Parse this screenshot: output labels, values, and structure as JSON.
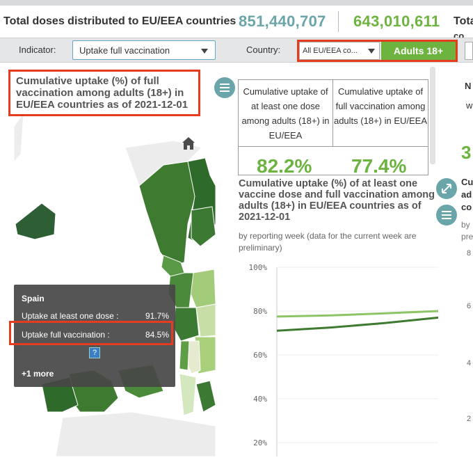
{
  "kpis": {
    "title": "Total doses distributed to EU/EEA countries",
    "value_1": "851,440,707",
    "value_2": "643,010,611",
    "title_2_cut": "Total",
    "title_2_cut_b": "co"
  },
  "filters": {
    "indicator_label": "Indicator:",
    "indicator_value": "Uptake full vaccination",
    "country_label": "Country:",
    "country_value": "All EU/EEA co...",
    "group_button": "Adults 18+"
  },
  "map": {
    "title": "Cumulative uptake (%) of full vaccination among adults (18+) in EU/EEA countries as of 2021-12-01",
    "tooltip": {
      "country": "Spain",
      "rows": [
        {
          "label": "Uptake at least one dose :",
          "value": "91.7%"
        },
        {
          "label": "Uptake full vaccination :",
          "value": "84.5%"
        }
      ],
      "help": "?",
      "more": "+1 more"
    }
  },
  "kpi_table": {
    "col1": "Cumulative uptake of at least one dose among adults (18+) in EU/EEA",
    "col2": "Cumulative uptake of full vaccination among adults (18+) in EU/EEA",
    "val1": "82.2%",
    "val2": "77.4%"
  },
  "line_chart": {
    "title": "Cumulative uptake (%) of at least one vaccine dose and full vaccination among adults (18+) in EU/EEA countries as of 2021-12-01",
    "subtitle": "by reporting week (data for the current week are preliminary)"
  },
  "chart_data": {
    "type": "line",
    "ylim": [
      0,
      100
    ],
    "yticks": [
      "100%",
      "80%",
      "60%",
      "40%",
      "20%"
    ],
    "series": [
      {
        "values": [
          77.5,
          78.0,
          79.0,
          80.0
        ],
        "color": "#8cc466"
      },
      {
        "values": [
          71.0,
          72.5,
          74.5,
          77.0
        ],
        "color": "#3e7a30"
      }
    ]
  },
  "right_panel": {
    "cut_lines": [
      "N",
      "w",
      "3",
      "Cu",
      "ad",
      "co",
      "by",
      "pre"
    ],
    "cut_ticks": [
      "8",
      "6",
      "4",
      "2"
    ]
  },
  "colors": {
    "highlight": "#e53c1f",
    "green": "#6db33f",
    "teal": "#6aa5a9"
  }
}
